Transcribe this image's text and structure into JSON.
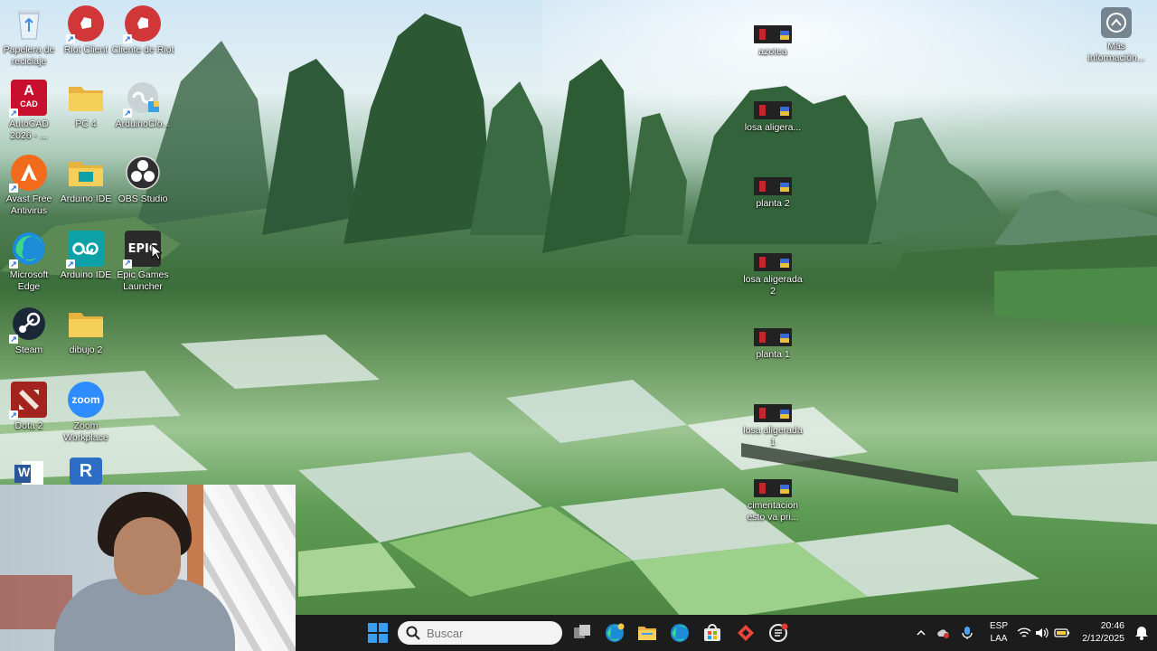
{
  "desktop": {
    "icons_left": [
      {
        "label": "Papelera de reciclaje",
        "icon": "recycle-bin-icon",
        "color": "#e8f0f8"
      },
      {
        "label": "Riot Client",
        "icon": "riot-fist-icon",
        "color": "#d13639"
      },
      {
        "label": "Cliente de Riot",
        "icon": "riot-fist-icon",
        "color": "#d13639"
      },
      {
        "label": "AutoCAD 2026 - ...",
        "icon": "autocad-icon",
        "color": "#c8102e"
      },
      {
        "label": "PC 4",
        "icon": "folder-icon",
        "color": "#f2c94c"
      },
      {
        "label": "ArduinoClo...",
        "icon": "arduino-cloud-icon",
        "color": "#7a8a8f"
      },
      {
        "label": "Avast Free Antivirus",
        "icon": "avast-icon",
        "color": "#f26b1d"
      },
      {
        "label": "Arduino IDE",
        "icon": "folder-icon",
        "color": "#f2c94c"
      },
      {
        "label": "OBS Studio",
        "icon": "obs-icon",
        "color": "#302e31"
      },
      {
        "label": "Microsoft Edge",
        "icon": "edge-icon",
        "color": "#1c8bd8"
      },
      {
        "label": "Arduino IDE",
        "icon": "arduino-icon",
        "color": "#0ca1a6"
      },
      {
        "label": "Epic Games Launcher",
        "icon": "epic-games-icon",
        "color": "#2a2a2a"
      },
      {
        "label": "Steam",
        "icon": "steam-icon",
        "color": "#1b2838"
      },
      {
        "label": "dibujo 2",
        "icon": "folder-icon",
        "color": "#f2c94c"
      },
      {
        "label": "Dota 2",
        "icon": "dota-icon",
        "color": "#a3231f"
      },
      {
        "label": "Zoom Workplace",
        "icon": "zoom-icon",
        "color": "#2d8cff"
      },
      {
        "label": "",
        "icon": "word-icon",
        "color": "#2b579a"
      },
      {
        "label": "",
        "icon": "r-icon",
        "color": "#2c6ec3"
      }
    ],
    "icon_texts": {
      "cad": "CAD",
      "a": "A",
      "epic": "EPIC",
      "zoom": "zoom",
      "r": "R",
      "w": "W"
    },
    "icons_mid": [
      {
        "label": "azotea",
        "icon": "autocad-file-icon"
      },
      {
        "label": "losa aligera...",
        "icon": "autocad-file-icon"
      },
      {
        "label": "planta 2",
        "icon": "autocad-file-icon"
      },
      {
        "label": "losa aligerada 2",
        "icon": "autocad-file-icon"
      },
      {
        "label": "planta 1",
        "icon": "autocad-file-icon"
      },
      {
        "label": "losa aligerada 1",
        "icon": "autocad-file-icon"
      },
      {
        "label": "cimentacion esto va pri...",
        "icon": "autocad-file-icon"
      }
    ],
    "info_icon": {
      "label": "Más información...",
      "icon": "info-camera-icon"
    }
  },
  "taskbar": {
    "search_placeholder": "Buscar",
    "apps": [
      "start-icon",
      "task-view-icon",
      "edge-beta-icon",
      "file-explorer-icon",
      "edge-icon",
      "store-icon",
      "anydesk-icon",
      "chatgpt-icon"
    ],
    "lang_line1": "ESP",
    "lang_line2": "LAA",
    "time": "20:46",
    "date": "2/12/2025"
  }
}
